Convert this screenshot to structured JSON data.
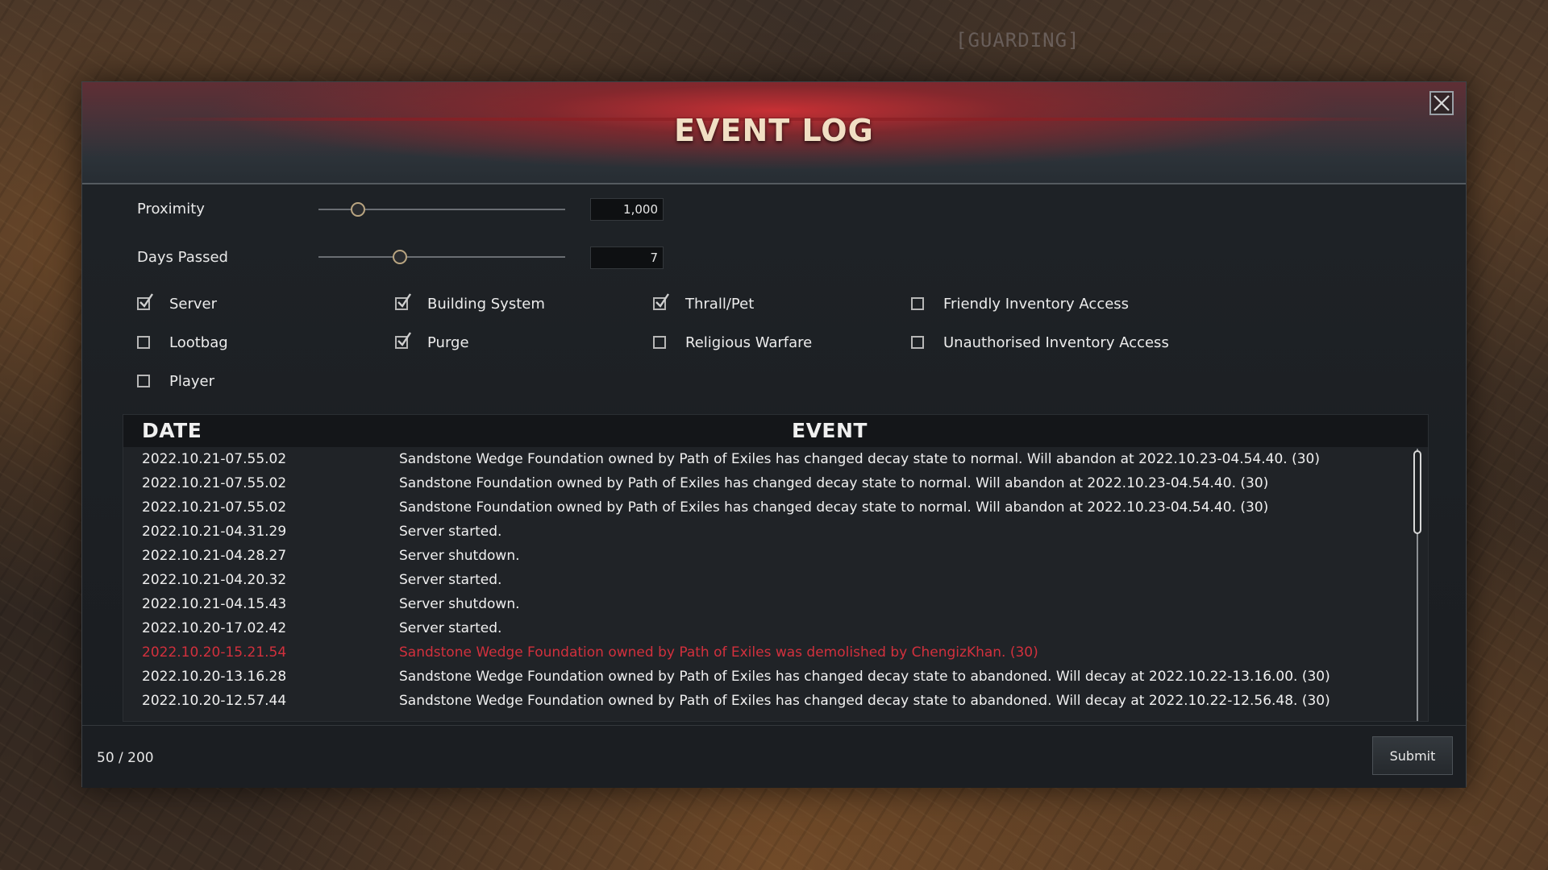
{
  "background": {
    "status_text": "[GUARDING]"
  },
  "window": {
    "title": "EVENT LOG",
    "close_icon": "close-icon"
  },
  "controls": {
    "proximity": {
      "label": "Proximity",
      "value": "1,000",
      "slider_fraction": 0.16
    },
    "days_passed": {
      "label": "Days Passed",
      "value": "7",
      "slider_fraction": 0.33
    }
  },
  "filters": [
    {
      "label": "Server",
      "checked": true
    },
    {
      "label": "Building System",
      "checked": true
    },
    {
      "label": "Thrall/Pet",
      "checked": true
    },
    {
      "label": "Friendly Inventory Access",
      "checked": false
    },
    {
      "label": "Lootbag",
      "checked": false
    },
    {
      "label": "Purge",
      "checked": true
    },
    {
      "label": "Religious Warfare",
      "checked": false
    },
    {
      "label": "Unauthorised Inventory Access",
      "checked": false
    },
    {
      "label": "Player",
      "checked": false
    }
  ],
  "table": {
    "columns": {
      "date": "DATE",
      "event": "EVENT"
    },
    "rows": [
      {
        "date": "2022.10.21-07.55.02",
        "event": "Sandstone Wedge Foundation owned by Path of Exiles has changed decay state to normal. Will abandon at 2022.10.23-04.54.40. (30)",
        "alert": false
      },
      {
        "date": "2022.10.21-07.55.02",
        "event": "Sandstone Foundation owned by Path of Exiles has changed decay state to normal. Will abandon at 2022.10.23-04.54.40. (30)",
        "alert": false
      },
      {
        "date": "2022.10.21-07.55.02",
        "event": "Sandstone Foundation owned by Path of Exiles has changed decay state to normal. Will abandon at 2022.10.23-04.54.40. (30)",
        "alert": false
      },
      {
        "date": "2022.10.21-04.31.29",
        "event": "Server started.",
        "alert": false
      },
      {
        "date": "2022.10.21-04.28.27",
        "event": "Server shutdown.",
        "alert": false
      },
      {
        "date": "2022.10.21-04.20.32",
        "event": "Server started.",
        "alert": false
      },
      {
        "date": "2022.10.21-04.15.43",
        "event": "Server shutdown.",
        "alert": false
      },
      {
        "date": "2022.10.20-17.02.42",
        "event": "Server started.",
        "alert": false
      },
      {
        "date": "2022.10.20-15.21.54",
        "event": "Sandstone Wedge Foundation owned by Path of Exiles was demolished by ChengizKhan. (30)",
        "alert": true
      },
      {
        "date": "2022.10.20-13.16.28",
        "event": "Sandstone Wedge Foundation owned by Path of Exiles has changed decay state to abandoned. Will decay at 2022.10.22-13.16.00. (30)",
        "alert": false
      },
      {
        "date": "2022.10.20-12.57.44",
        "event": "Sandstone Wedge Foundation owned by Path of Exiles has changed decay state to abandoned. Will decay at 2022.10.22-12.56.48. (30)",
        "alert": false
      }
    ],
    "scroll_fraction": 0.0
  },
  "footer": {
    "page_count": "50 / 200",
    "submit_label": "Submit"
  },
  "colors": {
    "alert_text": "#d2303d",
    "title_text": "#f1dfc4",
    "header_red": "#cd3034"
  }
}
